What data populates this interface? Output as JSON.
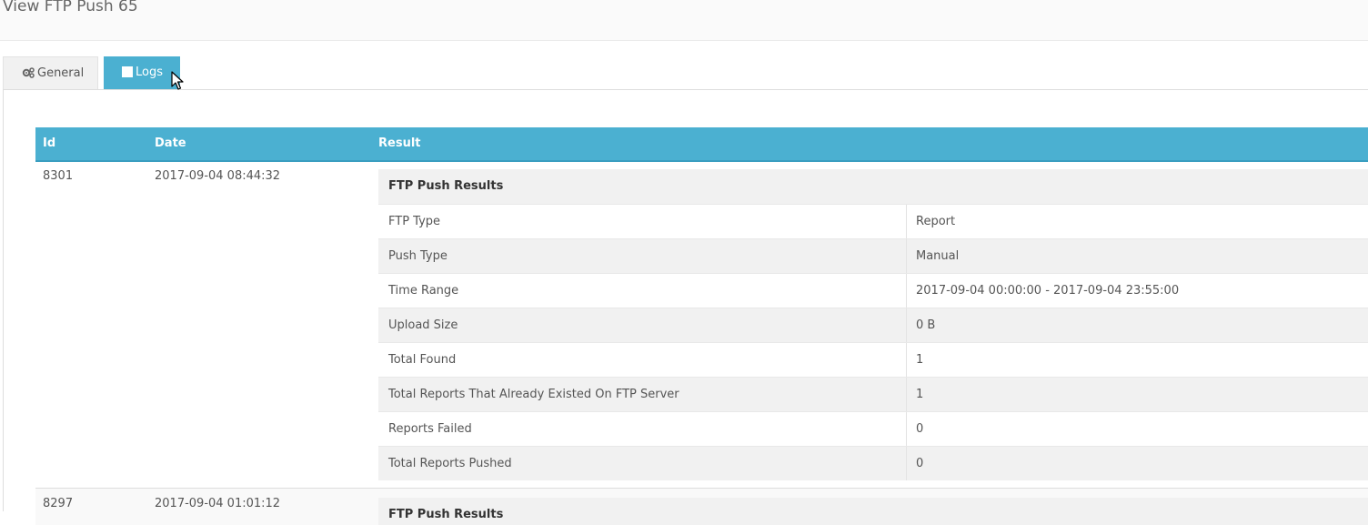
{
  "page": {
    "title": "View FTP Push 65"
  },
  "tabs": [
    {
      "label": "General",
      "icon": "gears-icon",
      "active": false
    },
    {
      "label": "Logs",
      "icon": "table-icon",
      "active": true
    }
  ],
  "colors": {
    "accent": "#4bb0d1",
    "stripe": "#f1f1f1"
  },
  "logs": {
    "columns": [
      "Id",
      "Date",
      "Result"
    ],
    "rows": [
      {
        "id": "8301",
        "date": "2017-09-04 08:44:32",
        "result": {
          "title": "FTP Push Results",
          "fields": [
            {
              "key": "FTP Type",
              "value": "Report"
            },
            {
              "key": "Push Type",
              "value": "Manual"
            },
            {
              "key": "Time Range",
              "value": "2017-09-04 00:00:00 - 2017-09-04 23:55:00"
            },
            {
              "key": "Upload Size",
              "value": "0 B"
            },
            {
              "key": "Total Found",
              "value": "1"
            },
            {
              "key": "Total Reports That Already Existed On FTP Server",
              "value": "1"
            },
            {
              "key": "Reports Failed",
              "value": "0"
            },
            {
              "key": "Total Reports Pushed",
              "value": "0"
            }
          ]
        }
      },
      {
        "id": "8297",
        "date": "2017-09-04 01:01:12",
        "result": {
          "title": "FTP Push Results"
        }
      }
    ]
  }
}
